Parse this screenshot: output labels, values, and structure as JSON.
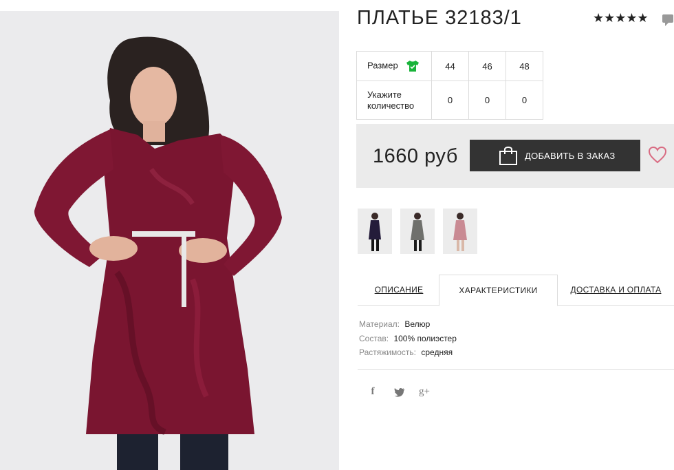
{
  "product": {
    "title": "ПЛАТЬЕ 32183/1",
    "rating_stars": "★★★★★",
    "rating_value": 5
  },
  "sizes": {
    "size_label": "Размер",
    "qty_label": "Укажите количество",
    "columns": [
      {
        "size": "44",
        "qty": "0"
      },
      {
        "size": "46",
        "qty": "0"
      },
      {
        "size": "48",
        "qty": "0"
      }
    ]
  },
  "purchase": {
    "price": "1660 руб",
    "add_button": "ДОБАВИТЬ В ЗАКАЗ"
  },
  "tabs": [
    {
      "label": "ОПИСАНИЕ",
      "active": false
    },
    {
      "label": "ХАРАКТЕРИСТИКИ",
      "active": true
    },
    {
      "label": "ДОСТАВКА И ОПЛАТА",
      "active": false
    }
  ],
  "specs": [
    {
      "key": "Материал:",
      "value": "Велюр"
    },
    {
      "key": "Состав:",
      "value": "100% полиэстер"
    },
    {
      "key": "Растяжимость:",
      "value": "средняя"
    }
  ],
  "social": {
    "facebook": "f",
    "twitter": "🐦",
    "googleplus": "g+"
  },
  "colors": {
    "dress": "#7a1530",
    "button_bg": "#333333",
    "size_icon": "#19b33a",
    "buy_box_bg": "#ebebeb",
    "heart": "#d96b82"
  },
  "icons": [
    "comment-icon",
    "shirt-size-icon",
    "shopping-bag-icon",
    "heart-icon",
    "facebook-icon",
    "twitter-icon",
    "google-plus-icon"
  ]
}
